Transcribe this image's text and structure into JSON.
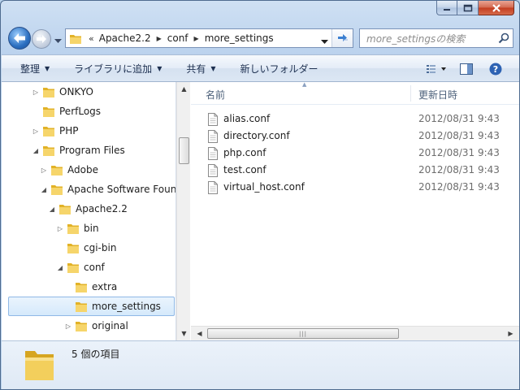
{
  "window": {
    "caption_buttons": [
      "minimize",
      "maximize",
      "close"
    ]
  },
  "address_bar": {
    "overflow_symbol": "«",
    "crumbs": [
      "Apache2.2",
      "conf",
      "more_settings"
    ]
  },
  "search": {
    "placeholder": "more_settingsの検索"
  },
  "commands": {
    "organize": "整理",
    "add_to_library": "ライブラリに追加",
    "share": "共有",
    "new_folder": "新しいフォルダー"
  },
  "tree": [
    {
      "label": "ONKYO",
      "level": 0,
      "toggle": "collapsed"
    },
    {
      "label": "PerfLogs",
      "level": 0,
      "toggle": "none"
    },
    {
      "label": "PHP",
      "level": 0,
      "toggle": "collapsed"
    },
    {
      "label": "Program Files",
      "level": 0,
      "toggle": "expanded"
    },
    {
      "label": "Adobe",
      "level": 1,
      "toggle": "collapsed"
    },
    {
      "label": "Apache Software Foundation",
      "level": 1,
      "toggle": "expanded"
    },
    {
      "label": "Apache2.2",
      "level": 2,
      "toggle": "expanded"
    },
    {
      "label": "bin",
      "level": 3,
      "toggle": "collapsed"
    },
    {
      "label": "cgi-bin",
      "level": 3,
      "toggle": "none"
    },
    {
      "label": "conf",
      "level": 3,
      "toggle": "expanded"
    },
    {
      "label": "extra",
      "level": 4,
      "toggle": "none"
    },
    {
      "label": "more_settings",
      "level": 4,
      "toggle": "none",
      "selected": true
    },
    {
      "label": "original",
      "level": 4,
      "toggle": "collapsed"
    }
  ],
  "columns": {
    "name": "名前",
    "modified": "更新日時"
  },
  "files": [
    {
      "name": "alias.conf",
      "modified": "2012/08/31 9:43"
    },
    {
      "name": "directory.conf",
      "modified": "2012/08/31 9:43"
    },
    {
      "name": "php.conf",
      "modified": "2012/08/31 9:43"
    },
    {
      "name": "test.conf",
      "modified": "2012/08/31 9:43"
    },
    {
      "name": "virtual_host.conf",
      "modified": "2012/08/31 9:43"
    }
  ],
  "status": {
    "item_count": "5 個の項目"
  },
  "colors": {
    "accent": "#2b6fc0",
    "folder": "#f0c63d",
    "selection": "#d5e9fb",
    "close": "#c33c1f"
  }
}
